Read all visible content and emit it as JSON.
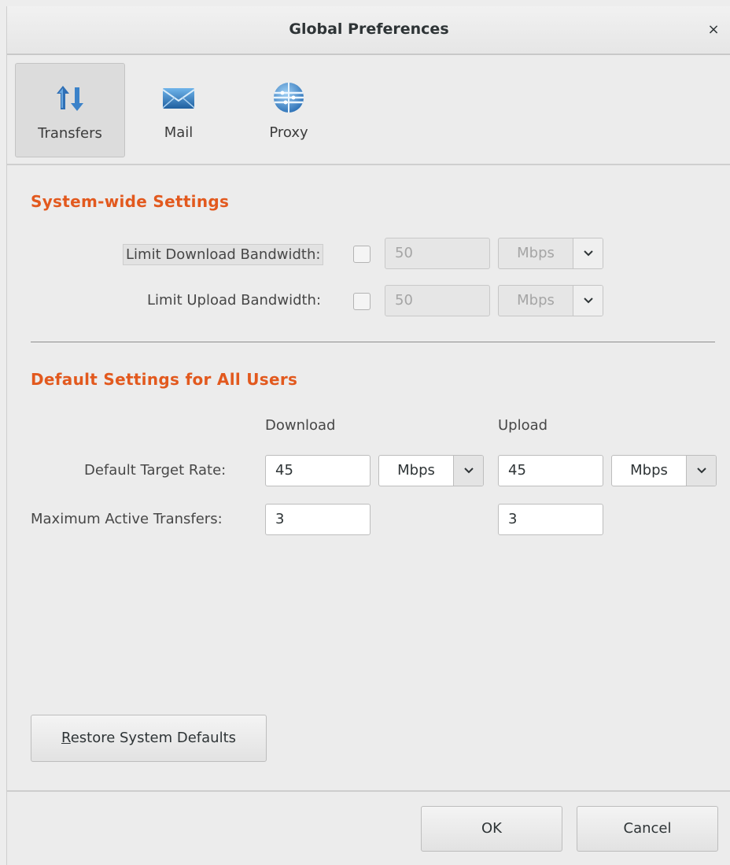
{
  "window": {
    "title": "Global Preferences",
    "close_glyph": "×"
  },
  "toolbar": {
    "items": [
      {
        "label": "Transfers",
        "icon": "transfers-icon",
        "selected": true
      },
      {
        "label": "Mail",
        "icon": "mail-icon",
        "selected": false
      },
      {
        "label": "Proxy",
        "icon": "proxy-icon",
        "selected": false
      }
    ]
  },
  "system_settings": {
    "heading": "System-wide Settings",
    "download": {
      "label": "Limit Download Bandwidth:",
      "checked": false,
      "value": "50",
      "unit": "Mbps"
    },
    "upload": {
      "label": "Limit Upload Bandwidth:",
      "checked": false,
      "value": "50",
      "unit": "Mbps"
    }
  },
  "default_settings": {
    "heading": "Default Settings for All Users",
    "col_download": "Download",
    "col_upload": "Upload",
    "target_rate": {
      "label": "Default Target Rate:",
      "download_value": "45",
      "download_unit": "Mbps",
      "upload_value": "45",
      "upload_unit": "Mbps"
    },
    "max_transfers": {
      "label": "Maximum Active Transfers:",
      "download_value": "3",
      "upload_value": "3"
    }
  },
  "buttons": {
    "restore_mnemonic": "R",
    "restore_rest": "estore System Defaults",
    "ok": "OK",
    "cancel": "Cancel"
  },
  "colors": {
    "heading_accent": "#e2591e",
    "background": "#ececec"
  }
}
